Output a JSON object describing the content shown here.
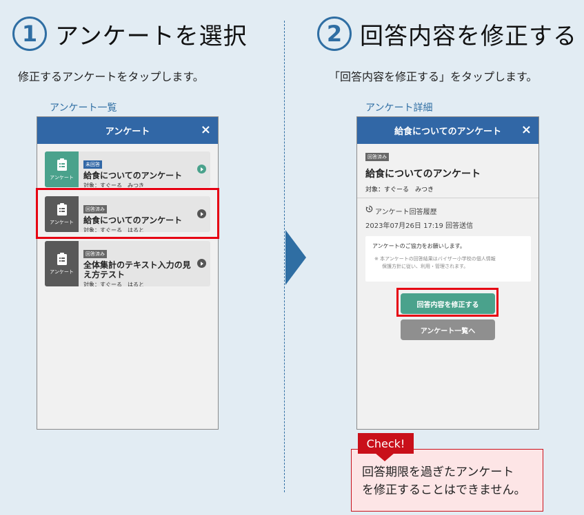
{
  "step1": {
    "number": "1",
    "title": "アンケートを選択",
    "description": "修正するアンケートをタップします。",
    "caption": "アンケート一覧"
  },
  "step2": {
    "number": "2",
    "title": "回答内容を修正する",
    "description": "「回答内容を修正する」をタップします。",
    "caption": "アンケート詳細"
  },
  "list_screen": {
    "header_title": "アンケート",
    "close_icon": "×",
    "items": [
      {
        "icon": "clipboard-icon",
        "icon_label": "アンケート",
        "badge": "未回答",
        "title": "給食についてのアンケート",
        "target": "対象：すぐーる　みつき",
        "status_color": "#4aa28c"
      },
      {
        "icon": "clipboard-icon",
        "icon_label": "アンケート",
        "badge": "回答済み",
        "title": "給食についてのアンケート",
        "target": "対象：すぐーる　はると",
        "status_color": "#595959"
      },
      {
        "icon": "clipboard-icon",
        "icon_label": "アンケート",
        "badge": "回答済み",
        "title_line1": "全体集計のテキスト入力の見",
        "title_line2": "え方テスト",
        "target": "対象：すぐーる　はると",
        "status_color": "#595959"
      }
    ]
  },
  "detail_screen": {
    "header_title": "給食についてのアンケート",
    "close_icon": "×",
    "badge": "回答済み",
    "title": "給食についてのアンケート",
    "target": "対象：すぐーる　みつき",
    "history_icon": "history-icon",
    "history_label": "アンケート回答履歴",
    "history_date": "2023年07月26日 17:19 回答送信",
    "notice_title": "アンケートのご協力をお願いします。",
    "notice_note_line1": "※ 本アンケートの回答結果はバイザー小学校の個人情報",
    "notice_note_line2": "保護方針に従い、利用・管理されます。",
    "modify_button": "回答内容を修正する",
    "back_button": "アンケート一覧へ"
  },
  "check": {
    "label": "Check!",
    "line1": "回答期限を過ぎたアンケート",
    "line2": "を修正することはできません。"
  },
  "colors": {
    "accent": "#2f6ea3",
    "header": "#3167a6",
    "teal": "#4aa28c",
    "highlight": "#e60012",
    "check_red": "#c9101a"
  }
}
